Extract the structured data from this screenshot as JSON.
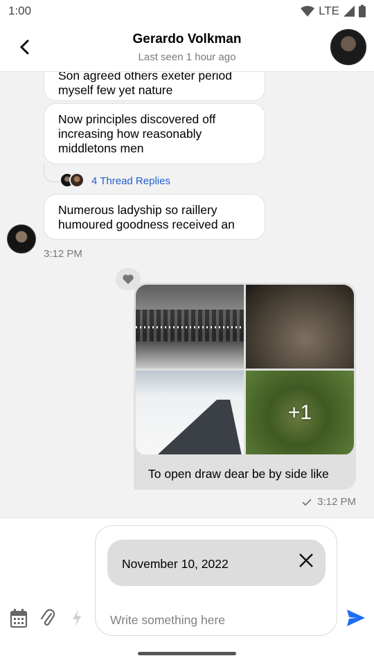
{
  "status_bar": {
    "time": "1:00",
    "network": "LTE"
  },
  "header": {
    "title": "Gerardo Volkman",
    "subtitle": "Last seen 1 hour ago"
  },
  "messages": [
    {
      "text": "Son agreed others exeter period myself few yet nature"
    },
    {
      "text": "Now principles discovered off increasing how reasonably middletons men"
    },
    {
      "text": "Numerous ladyship so raillery humoured goodness received an"
    }
  ],
  "thread": {
    "label": "4 Thread Replies"
  },
  "incoming_time": "3:12 PM",
  "outgoing": {
    "extra_count": "+1",
    "caption": "To open draw dear be by side like",
    "time": "3:12 PM"
  },
  "composer": {
    "date_chip": "November 10, 2022",
    "placeholder": "Write something here"
  },
  "colors": {
    "link": "#1f5fd1",
    "send": "#1a6df5",
    "chat_bg": "#f2f2f2"
  }
}
